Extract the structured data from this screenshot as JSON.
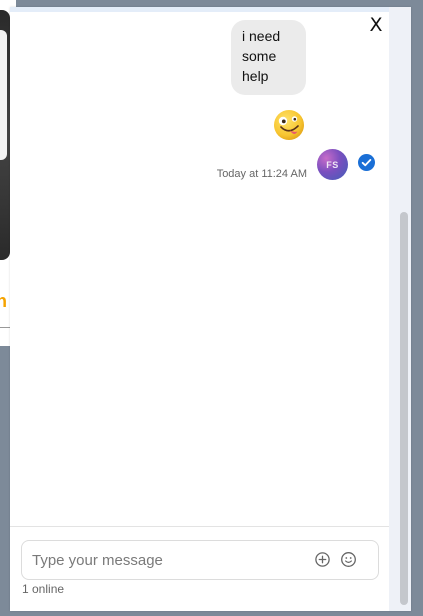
{
  "chat": {
    "close_label": "X",
    "message_lines": [
      "i need",
      "some",
      "help"
    ],
    "emoji_message": "zany-face-emoji",
    "timestamp": "Today at 11:24 AM",
    "avatar_initials": "FS",
    "read_status_icon": "check-circle-icon"
  },
  "composer": {
    "placeholder": "Type your message",
    "attach_icon": "plus-circle-icon",
    "emoji_icon": "smiley-icon"
  },
  "status": {
    "online": "1 online"
  },
  "colors": {
    "check_blue": "#1a6fd6",
    "bubble_bg": "#ebebeb",
    "background_orange": "#f5a300"
  }
}
